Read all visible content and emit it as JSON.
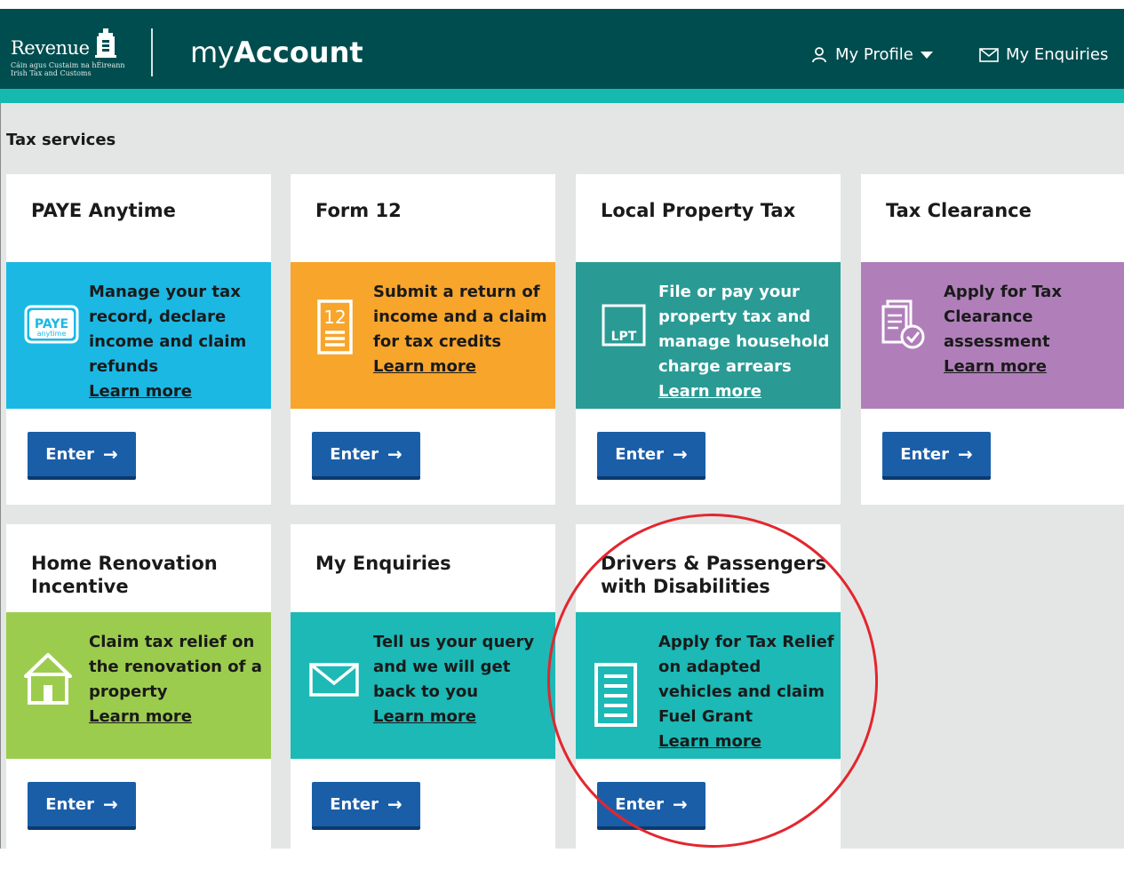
{
  "header": {
    "logo_text": "Revenue",
    "logo_sub_1": "Cáin agus Custaim na hÉireann",
    "logo_sub_2": "Irish Tax and Customs",
    "brand_my": "my",
    "brand_account": "Account",
    "profile_label": "My Profile",
    "enquiries_label": "My Enquiries"
  },
  "section_title": "Tax services",
  "enter_label": "Enter",
  "cards": [
    {
      "title": "PAYE Anytime",
      "description": "Manage your tax record, declare income and claim refunds",
      "learn_more": "Learn more",
      "color": "#1bb8e4",
      "icon": "paye-anytime-icon",
      "icon_text": "PAYE",
      "icon_subtext": "anytime"
    },
    {
      "title": "Form 12",
      "description": "Submit a return of income and a claim for tax credits",
      "learn_more": "Learn more",
      "color": "#f8a52c",
      "icon": "form-12-icon",
      "icon_text": "12"
    },
    {
      "title": "Local Property Tax",
      "description": "File or pay your property tax and manage household charge arrears",
      "learn_more": "Learn more",
      "color": "#2a9a94",
      "icon": "lpt-icon",
      "icon_text": "LPT"
    },
    {
      "title": "Tax Clearance",
      "description": "Apply for Tax Clearance assessment",
      "learn_more": "Learn more",
      "color": "#b07fba",
      "icon": "document-check-icon"
    },
    {
      "title": "Home Renovation Incentive",
      "description": "Claim tax relief on the renovation of a property",
      "learn_more": "Learn more",
      "color": "#9ccc4e",
      "icon": "house-icon"
    },
    {
      "title": "My Enquiries",
      "description": "Tell us your query and we will get back to you",
      "learn_more": "Learn more",
      "color": "#1cb9b6",
      "icon": "envelope-icon"
    },
    {
      "title": "Drivers & Passengers with Disabilities",
      "description": "Apply for Tax Relief on adapted vehicles and claim Fuel Grant",
      "learn_more": "Learn more",
      "color": "#1cb9b6",
      "icon": "document-lines-icon"
    }
  ],
  "colors": {
    "header_bg": "#004d4f",
    "accent_bar": "#15b9b0",
    "button": "#1b5ea8",
    "highlight_circle": "#e3262e"
  }
}
